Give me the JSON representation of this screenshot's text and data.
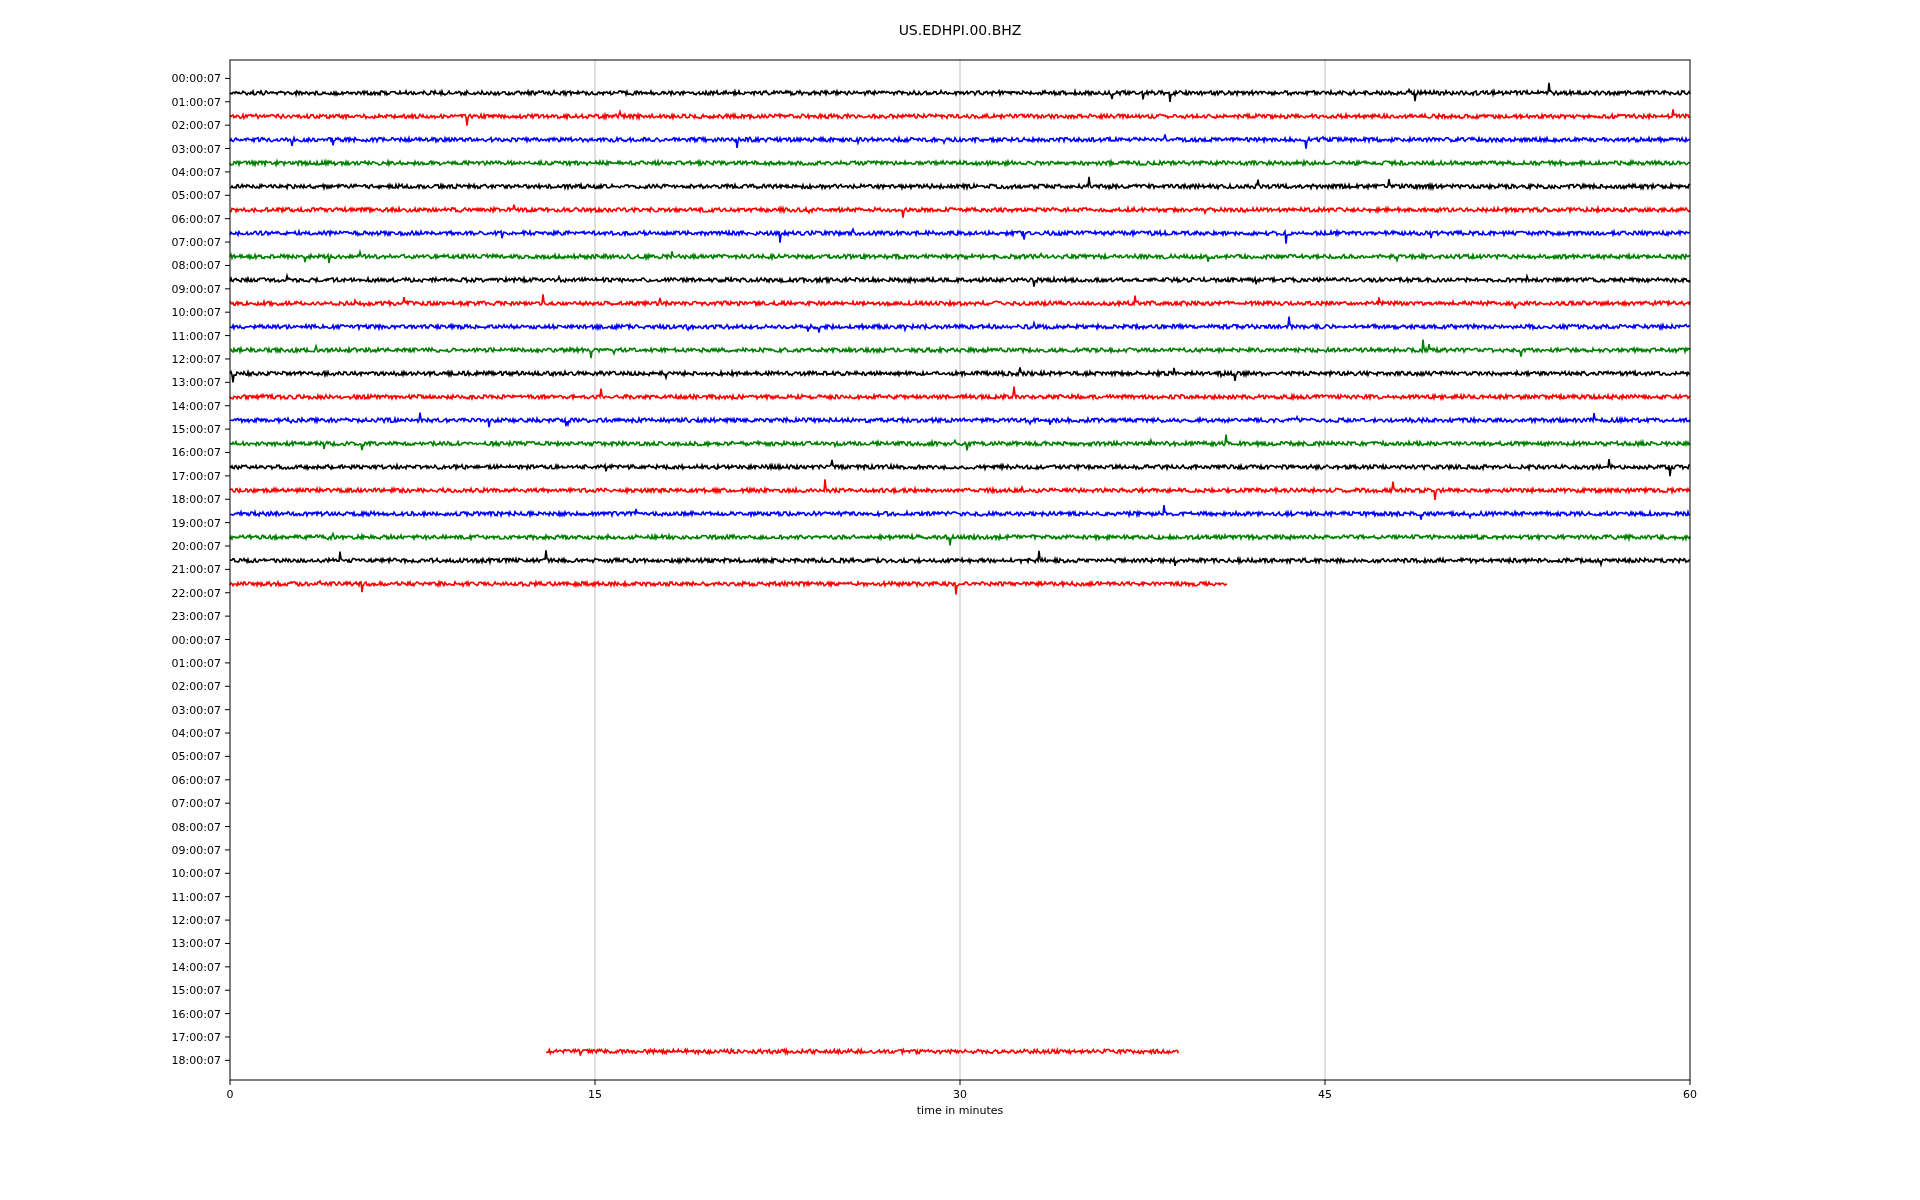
{
  "title": "US.EDHPI.00.BHZ",
  "x_axis": {
    "label": "time in minutes",
    "ticks": [
      "0",
      "15",
      "30",
      "45",
      "60"
    ]
  },
  "rows": [
    {
      "label": "00:00:07",
      "trace": {
        "color": "#000000",
        "kind": "full"
      }
    },
    {
      "label": "01:00:07",
      "trace": {
        "color": "#ff0000",
        "kind": "full"
      }
    },
    {
      "label": "02:00:07",
      "trace": {
        "color": "#0000ff",
        "kind": "full"
      }
    },
    {
      "label": "03:00:07",
      "trace": {
        "color": "#008000",
        "kind": "full"
      }
    },
    {
      "label": "04:00:07",
      "trace": {
        "color": "#000000",
        "kind": "full"
      }
    },
    {
      "label": "05:00:07",
      "trace": {
        "color": "#ff0000",
        "kind": "full"
      }
    },
    {
      "label": "06:00:07",
      "trace": {
        "color": "#0000ff",
        "kind": "full"
      }
    },
    {
      "label": "07:00:07",
      "trace": {
        "color": "#008000",
        "kind": "full"
      }
    },
    {
      "label": "08:00:07",
      "trace": {
        "color": "#000000",
        "kind": "full"
      }
    },
    {
      "label": "09:00:07",
      "trace": {
        "color": "#ff0000",
        "kind": "full"
      }
    },
    {
      "label": "10:00:07",
      "trace": {
        "color": "#0000ff",
        "kind": "full"
      }
    },
    {
      "label": "11:00:07",
      "trace": {
        "color": "#008000",
        "kind": "full"
      }
    },
    {
      "label": "12:00:07",
      "trace": {
        "color": "#000000",
        "kind": "full"
      }
    },
    {
      "label": "13:00:07",
      "trace": {
        "color": "#ff0000",
        "kind": "full"
      }
    },
    {
      "label": "14:00:07",
      "trace": {
        "color": "#0000ff",
        "kind": "full"
      }
    },
    {
      "label": "15:00:07",
      "trace": {
        "color": "#008000",
        "kind": "full"
      }
    },
    {
      "label": "16:00:07",
      "trace": {
        "color": "#000000",
        "kind": "full"
      }
    },
    {
      "label": "17:00:07",
      "trace": {
        "color": "#ff0000",
        "kind": "full"
      }
    },
    {
      "label": "18:00:07",
      "trace": {
        "color": "#0000ff",
        "kind": "full"
      }
    },
    {
      "label": "19:00:07",
      "trace": {
        "color": "#008000",
        "kind": "full"
      }
    },
    {
      "label": "20:00:07",
      "trace": {
        "color": "#000000",
        "kind": "full"
      }
    },
    {
      "label": "21:00:07",
      "trace": {
        "color": "#ff0000",
        "kind": "ends-early"
      }
    },
    {
      "label": "22:00:07"
    },
    {
      "label": "23:00:07"
    },
    {
      "label": "00:00:07"
    },
    {
      "label": "01:00:07"
    },
    {
      "label": "02:00:07"
    },
    {
      "label": "03:00:07"
    },
    {
      "label": "04:00:07"
    },
    {
      "label": "05:00:07"
    },
    {
      "label": "06:00:07"
    },
    {
      "label": "07:00:07"
    },
    {
      "label": "08:00:07"
    },
    {
      "label": "09:00:07"
    },
    {
      "label": "10:00:07"
    },
    {
      "label": "11:00:07"
    },
    {
      "label": "12:00:07"
    },
    {
      "label": "13:00:07"
    },
    {
      "label": "14:00:07"
    },
    {
      "label": "15:00:07"
    },
    {
      "label": "16:00:07"
    },
    {
      "label": "17:00:07",
      "trace": {
        "color": "#ff0000",
        "kind": "middle"
      }
    },
    {
      "label": "18:00:07"
    }
  ]
}
